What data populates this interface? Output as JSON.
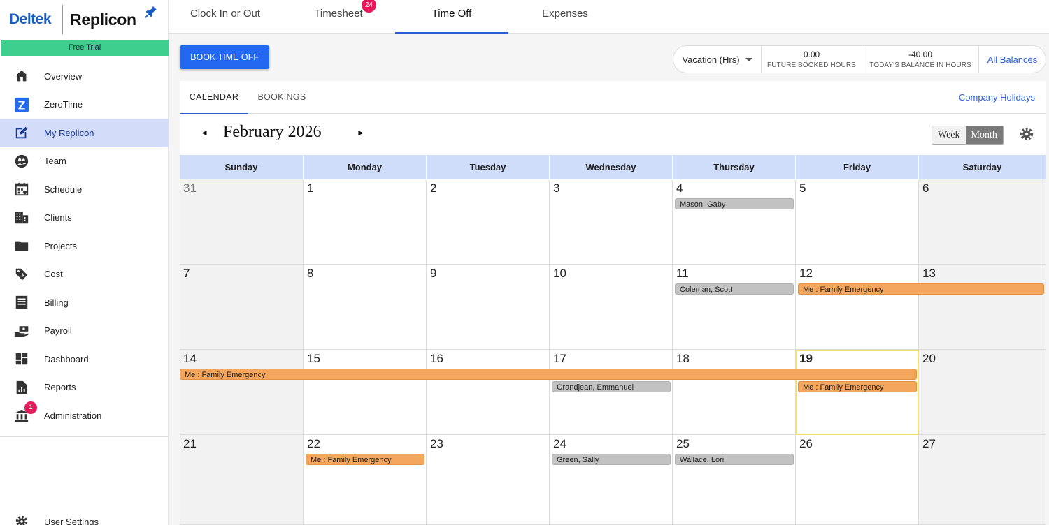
{
  "brand": {
    "left": "Deltek",
    "right": "Replicon"
  },
  "trial": "Free Trial",
  "sidebar": {
    "items": [
      {
        "label": "Overview",
        "icon": "home-icon"
      },
      {
        "label": "ZeroTime",
        "icon": "zerotime-icon"
      },
      {
        "label": "My Replicon",
        "icon": "edit-icon",
        "active": true
      },
      {
        "label": "Team",
        "icon": "team-icon"
      },
      {
        "label": "Schedule",
        "icon": "calendar-icon"
      },
      {
        "label": "Clients",
        "icon": "building-icon"
      },
      {
        "label": "Projects",
        "icon": "folder-icon"
      },
      {
        "label": "Cost",
        "icon": "tag-icon"
      },
      {
        "label": "Billing",
        "icon": "list-icon"
      },
      {
        "label": "Payroll",
        "icon": "payroll-icon"
      },
      {
        "label": "Dashboard",
        "icon": "dashboard-icon"
      },
      {
        "label": "Reports",
        "icon": "report-icon"
      },
      {
        "label": "Administration",
        "icon": "bank-icon",
        "badge": "1"
      }
    ],
    "user_settings": "User Settings"
  },
  "topnav": {
    "tabs": [
      {
        "label": "Clock In or Out"
      },
      {
        "label": "Timesheet",
        "badge": "24"
      },
      {
        "label": "Time Off",
        "active": true
      },
      {
        "label": "Expenses"
      }
    ]
  },
  "actions": {
    "book_label": "BOOK TIME OFF"
  },
  "balance": {
    "type": "Vacation (Hrs)",
    "future_value": "0.00",
    "future_label": "FUTURE BOOKED HOURS",
    "today_value": "-40.00",
    "today_label": "TODAY'S BALANCE IN HOURS",
    "all_link": "All Balances"
  },
  "subtabs": {
    "calendar": "CALENDAR",
    "bookings": "BOOKINGS",
    "holidays": "Company Holidays"
  },
  "calendar": {
    "month_title": "February 2026",
    "prev": "◄",
    "next": "►",
    "view_week": "Week",
    "view_month": "Month",
    "weekdays": [
      "Sunday",
      "Monday",
      "Tuesday",
      "Wednesday",
      "Thursday",
      "Friday",
      "Saturday"
    ],
    "weeks": [
      [
        "31",
        "1",
        "2",
        "3",
        "4",
        "5",
        "6"
      ],
      [
        "7",
        "8",
        "9",
        "10",
        "11",
        "12",
        "13"
      ],
      [
        "14",
        "15",
        "16",
        "17",
        "18",
        "19",
        "20"
      ],
      [
        "21",
        "22",
        "23",
        "24",
        "25",
        "26",
        "27"
      ]
    ],
    "today": "19",
    "events": [
      {
        "label": "Mason, Gaby",
        "week": 0,
        "start": 4,
        "end": 4,
        "row": 0,
        "color": "gray"
      },
      {
        "label": "Coleman, Scott",
        "week": 1,
        "start": 4,
        "end": 4,
        "row": 0,
        "color": "gray"
      },
      {
        "label": "Me : Family Emergency",
        "week": 1,
        "start": 5,
        "end": 6,
        "row": 0,
        "color": "orange"
      },
      {
        "label": "Me : Family Emergency",
        "week": 2,
        "start": 0,
        "end": 5,
        "row": 0,
        "color": "orange"
      },
      {
        "label": "Grandjean, Emmanuel",
        "week": 2,
        "start": 3,
        "end": 3,
        "row": 1,
        "color": "gray"
      },
      {
        "label": "Me : Family Emergency",
        "week": 2,
        "start": 5,
        "end": 5,
        "row": 1,
        "color": "orange"
      },
      {
        "label": "Me : Family Emergency",
        "week": 3,
        "start": 1,
        "end": 1,
        "row": 0,
        "color": "orange"
      },
      {
        "label": "Green, Sally",
        "week": 3,
        "start": 3,
        "end": 3,
        "row": 0,
        "color": "gray"
      },
      {
        "label": "Wallace, Lori",
        "week": 3,
        "start": 4,
        "end": 4,
        "row": 0,
        "color": "gray"
      }
    ]
  }
}
